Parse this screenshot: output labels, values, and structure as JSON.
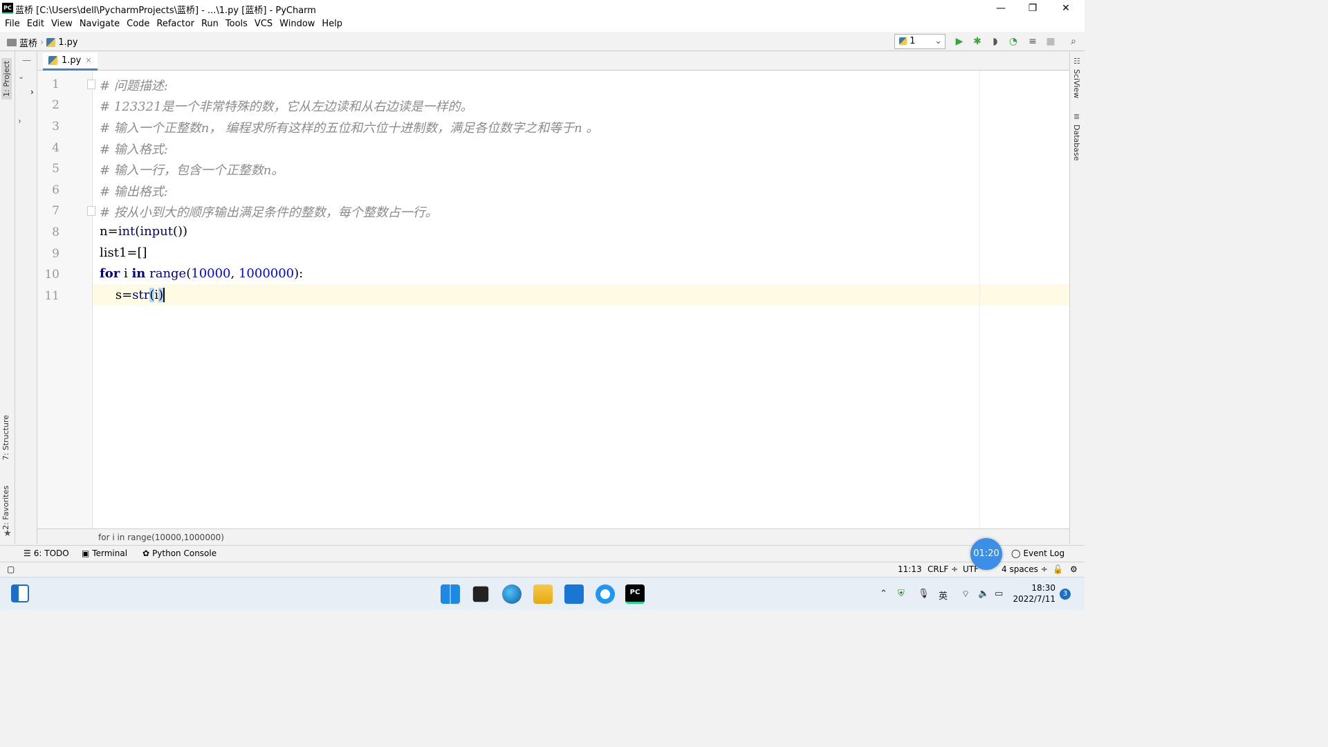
{
  "window": {
    "title": "蓝桥 [C:\\Users\\dell\\PycharmProjects\\蓝桥] - ...\\1.py [蓝桥] - PyCharm",
    "app_icon": "PC"
  },
  "menu": [
    "File",
    "Edit",
    "View",
    "Navigate",
    "Code",
    "Refactor",
    "Run",
    "Tools",
    "VCS",
    "Window",
    "Help"
  ],
  "breadcrumb": {
    "project": "蓝桥",
    "file": "1.py"
  },
  "run_config": {
    "selected": "1"
  },
  "side_tabs": {
    "project": "1: Project",
    "structure": "7: Structure",
    "favorites": "2: Favorites",
    "sciview": "SciView",
    "database": "Database"
  },
  "editor": {
    "tab_label": "1.py",
    "line_numbers": [
      "1",
      "2",
      "3",
      "4",
      "5",
      "6",
      "7",
      "8",
      "9",
      "10",
      "11"
    ],
    "lines": [
      "# 问题描述:",
      "# 123321是一个非常特殊的数，它从左边读和从右边读是一样的。",
      "# 输入一个正整数n， 编程求所有这样的五位和六位十进制数，满足各位数字之和等于n 。",
      "# 输入格式:",
      "# 输入一行，包含一个正整数n。",
      "# 输出格式:",
      "# 按从小到大的顺序输出满足条件的整数，每个整数占一行。"
    ],
    "code": {
      "l8_a": "n=",
      "l8_b": "int",
      "l8_c": "(",
      "l8_d": "input",
      "l8_e": "())",
      "l9": "list1=[]",
      "l10_kw1": "for",
      "l10_a": " i ",
      "l10_kw2": "in",
      "l10_b": " ",
      "l10_c": "range",
      "l10_d": "(",
      "l10_n1": "10000",
      "l10_e": ", ",
      "l10_n2": "1000000",
      "l10_f": "):",
      "l11_a": "    s=",
      "l11_b": "str",
      "l11_c": "(",
      "l11_d": "i",
      "l11_e": ")"
    },
    "scope_breadcrumb": "for i in range(10000,1000000)"
  },
  "tool_windows": {
    "todo": "6: TODO",
    "terminal": "Terminal",
    "console": "Python Console",
    "event_log": "Event Log"
  },
  "timer": "01:20",
  "status": {
    "position": "11:13",
    "line_sep": "CRLF ÷",
    "encoding": "UTF",
    "indent": "4 spaces ÷"
  },
  "taskbar": {
    "ime": "英",
    "time": "18:30",
    "date": "2022/7/11",
    "notif_count": "3"
  },
  "colors": {
    "keyword": "#000080",
    "number": "#0000ff",
    "comment": "#8c8c8c",
    "current_line": "#fffae3",
    "run_green": "#3ca23c"
  }
}
